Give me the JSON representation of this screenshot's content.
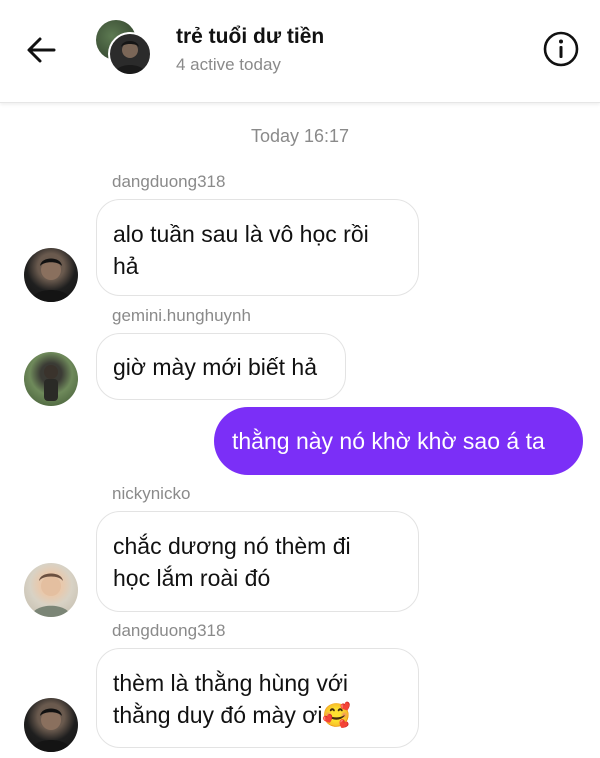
{
  "header": {
    "title": "trẻ tuổi dư tiền",
    "status": "4 active today"
  },
  "thread": {
    "timestamp": "Today 16:17",
    "messages": [
      {
        "sender": "dangduong318",
        "text_lines": [
          "alo tuần sau là vô học rồi",
          "hả"
        ]
      },
      {
        "sender": "gemini.hunghuynh",
        "text_lines": [
          "giờ mày mới biết hả"
        ]
      },
      {
        "sender": "",
        "text_lines": [
          "thằng này nó khờ khờ sao á ta"
        ]
      },
      {
        "sender": "nickynicko",
        "text_lines": [
          "chắc dương nó thèm đi",
          "học lắm roài đó"
        ]
      },
      {
        "sender": "dangduong318",
        "text_lines": [
          "thèm là thằng hùng với",
          "thằng duy đó mày ơi🥰"
        ]
      }
    ]
  }
}
